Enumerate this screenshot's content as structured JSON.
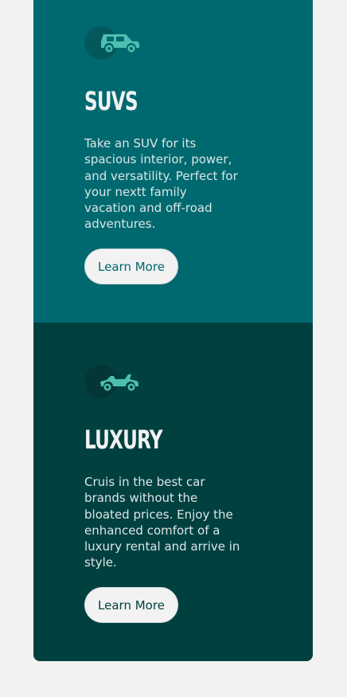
{
  "colors": {
    "page_background": "#f2f2f2",
    "suv_card": "#006970",
    "luxury_card": "#004140",
    "icon_accent": "#4dbfb0",
    "button_background": "#f2f2f2"
  },
  "cards": [
    {
      "icon": "suv-car-icon",
      "title": "SUVS",
      "text": "Take an SUV for its spacious interior, power, and versatility. Perfect for your nextt family vacation and off-road adventures.",
      "button_label": "Learn More"
    },
    {
      "icon": "convertible-car-icon",
      "title": "LUXURY",
      "text": "Cruis in the best car brands without the bloated prices. Enjoy the enhanced comfort of a luxury rental and arrive in style.",
      "button_label": "Learn More"
    }
  ]
}
